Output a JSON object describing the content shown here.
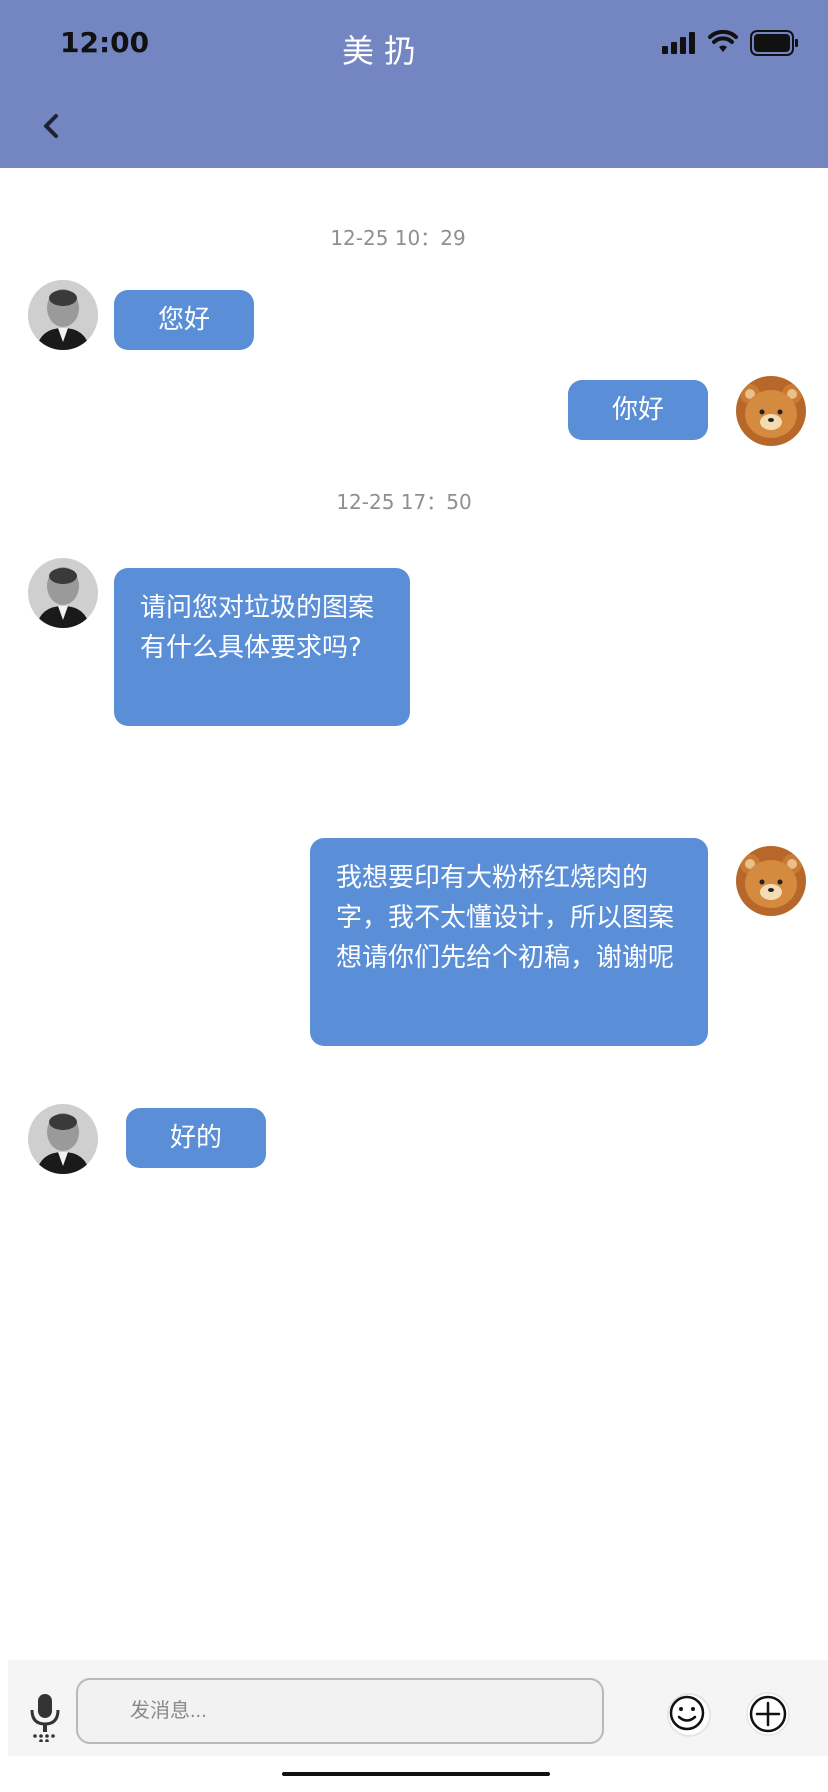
{
  "status_bar": {
    "time": "12:00"
  },
  "header": {
    "title": "美扔"
  },
  "messages": [
    {
      "type": "timestamp",
      "text": "12-25 10：29"
    },
    {
      "type": "message",
      "side": "left",
      "text": "您好"
    },
    {
      "type": "message",
      "side": "right",
      "text": "你好"
    },
    {
      "type": "timestamp",
      "text": "12-25 17：50"
    },
    {
      "type": "message",
      "side": "left",
      "text": "请问您对垃圾的图案有什么具体要求吗?"
    },
    {
      "type": "message",
      "side": "right",
      "text": "我想要印有大粉桥红烧肉的字，我不太懂设计，所以图案想请你们先给个初稿，谢谢呢"
    },
    {
      "type": "message",
      "side": "left",
      "text": "好的"
    }
  ],
  "input": {
    "placeholder": "发消息..."
  },
  "icons": {
    "back": "chevron-left-icon",
    "mic": "microphone-icon",
    "emoji": "smiley-icon",
    "plus": "plus-circle-icon",
    "signal": "cellular-signal-icon",
    "wifi": "wifi-icon",
    "battery": "battery-icon"
  },
  "colors": {
    "header": "#7386c1",
    "bubble": "#5a8fd8",
    "bubble_text": "#ffffff",
    "timestamp": "#8f8f8f",
    "input_bar": "#f5f5f5"
  }
}
